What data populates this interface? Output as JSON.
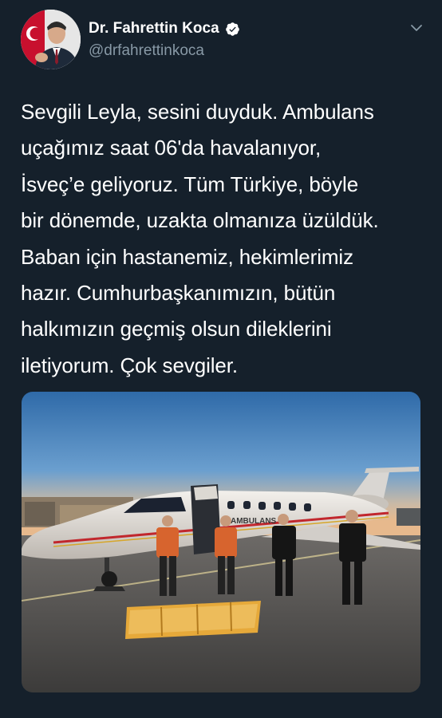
{
  "tweet": {
    "display_name": "Dr. Fahrettin Koca",
    "handle": "@drfahrettinkoca",
    "text_lines": [
      "Sevgili Leyla, sesini duyduk. Ambulans",
      "uçağımız saat 06'da havalanıyor,",
      "İsveç’e geliyoruz. Tüm Türkiye, böyle",
      "bir dönemde, uzakta olmanıza üzüldük.",
      "Baban için hastanemiz, hekimlerimiz",
      "hazır. Cumhurbaşkanımızın, bütün",
      "halkımızın geçmiş olsun dileklerini",
      "iletiyorum. Çok sevgiler."
    ],
    "media": {
      "aircraft_label": "AMBULANS"
    }
  },
  "icons": {
    "verified": "verified-badge-icon",
    "menu": "chevron-down-icon"
  },
  "colors": {
    "background": "#15202b",
    "secondary_text": "#8899a6",
    "primary_text": "#ffffff"
  }
}
